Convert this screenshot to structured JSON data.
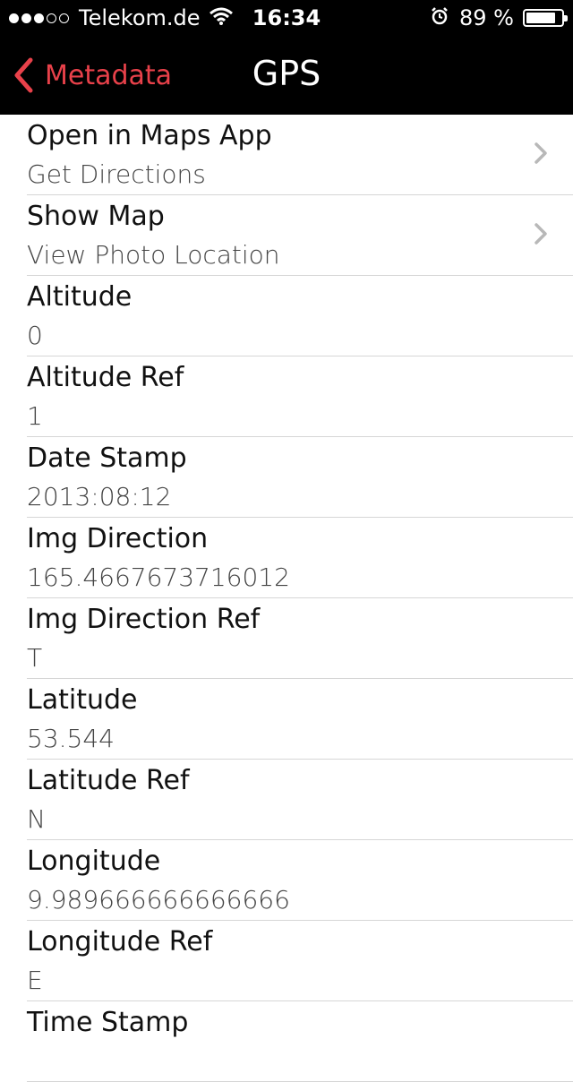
{
  "status_bar": {
    "carrier": "Telekom.de",
    "time": "16:34",
    "battery_percent_text": "89 %",
    "battery_level": 0.89,
    "signal_bars_filled": 3,
    "signal_bars_total": 5
  },
  "nav": {
    "back_label": "Metadata",
    "title": "GPS",
    "accent_color": "#e8414a"
  },
  "rows": [
    {
      "label": "Open in Maps App",
      "value": "Get Directions",
      "chevron": true
    },
    {
      "label": "Show Map",
      "value": "View Photo Location",
      "chevron": true
    },
    {
      "label": "Altitude",
      "value": "0"
    },
    {
      "label": "Altitude Ref",
      "value": "1"
    },
    {
      "label": "Date Stamp",
      "value": "2013:08:12"
    },
    {
      "label": "Img Direction",
      "value": "165.4667673716012"
    },
    {
      "label": "Img Direction Ref",
      "value": "T"
    },
    {
      "label": "Latitude",
      "value": "53.544"
    },
    {
      "label": "Latitude Ref",
      "value": "N"
    },
    {
      "label": "Longitude",
      "value": "9.989666666666666"
    },
    {
      "label": "Longitude Ref",
      "value": "E"
    },
    {
      "label": "Time Stamp",
      "value": ""
    }
  ]
}
